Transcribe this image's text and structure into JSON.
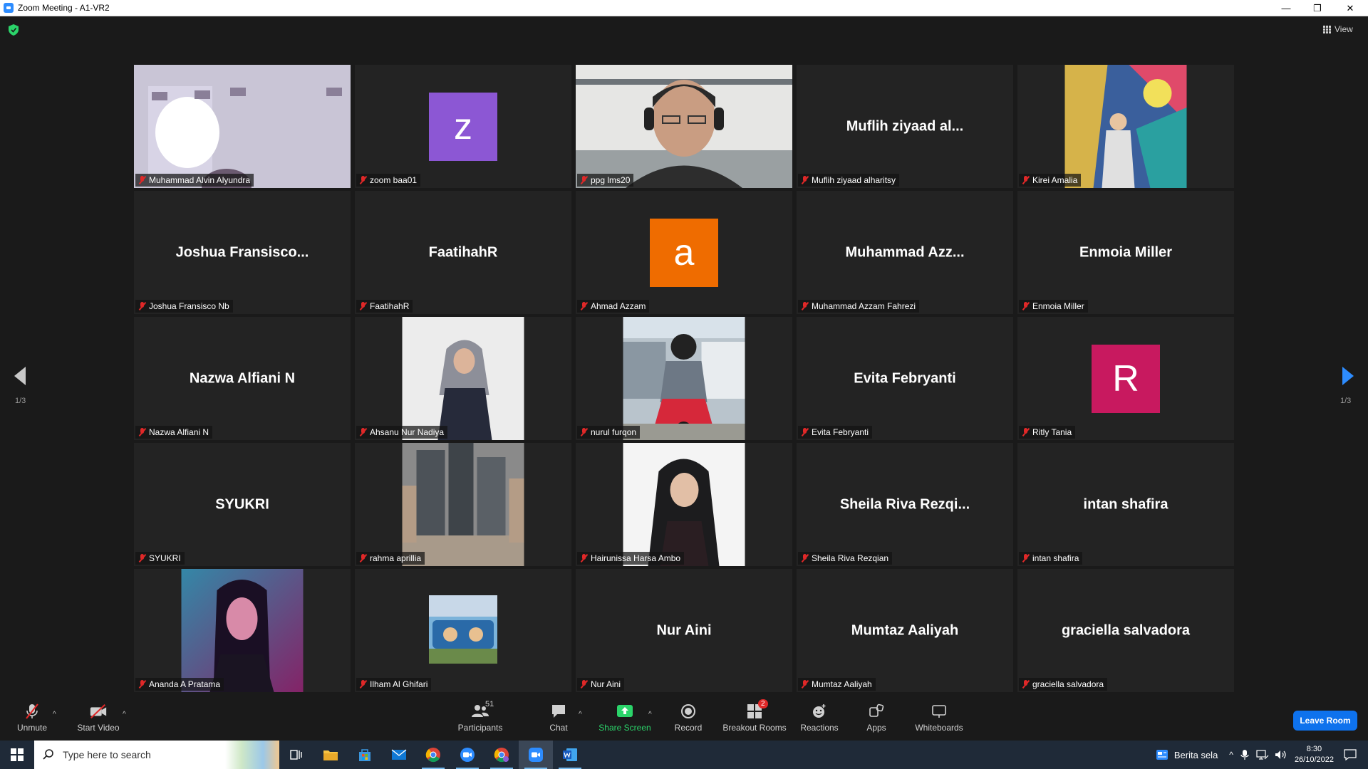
{
  "window": {
    "title": "Zoom Meeting - A1-VR2"
  },
  "meeting": {
    "view_label": "View",
    "page_left": "1/3",
    "page_right": "1/3",
    "tiles": [
      {
        "kind": "photo",
        "variant": "full",
        "art": "room",
        "name": "Muhammad Alvin Alyundra"
      },
      {
        "kind": "avatar",
        "letter": "z",
        "color": "#8c57d4",
        "name": "zoom baa01"
      },
      {
        "kind": "photo",
        "variant": "full",
        "art": "headset",
        "name": "ppg lms20",
        "active": true
      },
      {
        "kind": "text",
        "display": "Muflih ziyaad al...",
        "name": "Muflih ziyaad alharitsy"
      },
      {
        "kind": "photo",
        "variant": "narrow",
        "art": "colorful",
        "name": "Kirei Amalia"
      },
      {
        "kind": "text",
        "display": "Joshua  Fransisco...",
        "name": "Joshua Fransisco Nb"
      },
      {
        "kind": "text",
        "display": "FaatihahR",
        "name": "FaatihahR"
      },
      {
        "kind": "avatar",
        "letter": "a",
        "color": "#ef6c00",
        "name": "Ahmad Azzam"
      },
      {
        "kind": "text",
        "display": "Muhammad  Azz...",
        "name": "Muhammad Azzam Fahrezi"
      },
      {
        "kind": "text",
        "display": "Enmoia Miller",
        "name": "Enmoia Miller"
      },
      {
        "kind": "text",
        "display": "Nazwa Alfiani N",
        "name": "Nazwa Alfiani N"
      },
      {
        "kind": "photo",
        "variant": "narrow",
        "art": "hijab-white",
        "name": "Ahsanu Nur Nadiya"
      },
      {
        "kind": "photo",
        "variant": "narrow",
        "art": "motorbike",
        "name": "nurul furqon"
      },
      {
        "kind": "text",
        "display": "Evita Febryanti",
        "name": "Evita Febryanti"
      },
      {
        "kind": "avatar",
        "letter": "R",
        "color": "#c8195f",
        "name": "Ritly Tania"
      },
      {
        "kind": "text",
        "display": "SYUKRI",
        "name": "SYUKRI"
      },
      {
        "kind": "photo",
        "variant": "narrow",
        "art": "city",
        "name": "rahma aprillia"
      },
      {
        "kind": "photo",
        "variant": "narrow",
        "art": "hijab-black",
        "name": "Hairunissa Harsa Ambo"
      },
      {
        "kind": "text",
        "display": "Sheila  Riva  Rezqi...",
        "name": "Sheila Riva Rezqian"
      },
      {
        "kind": "text",
        "display": "intan shafira",
        "name": "intan shafira"
      },
      {
        "kind": "photo",
        "variant": "narrow",
        "art": "neon",
        "name": "Ananda A Pratama"
      },
      {
        "kind": "photo",
        "variant": "small",
        "art": "cartoon",
        "name": "Ilham Al Ghifari"
      },
      {
        "kind": "text",
        "display": "Nur Aini",
        "name": "Nur Aini"
      },
      {
        "kind": "text",
        "display": "Mumtaz Aaliyah",
        "name": "Mumtaz Aaliyah"
      },
      {
        "kind": "text",
        "display": "graciella salvadora",
        "name": "graciella salvadora"
      }
    ]
  },
  "toolbar": {
    "unmute": "Unmute",
    "start_video": "Start Video",
    "participants": "Participants",
    "participants_count": "51",
    "chat": "Chat",
    "share_screen": "Share Screen",
    "record": "Record",
    "breakout_rooms": "Breakout Rooms",
    "breakout_badge": "2",
    "reactions": "Reactions",
    "apps": "Apps",
    "whiteboards": "Whiteboards",
    "leave": "Leave Room"
  },
  "taskbar": {
    "search_placeholder": "Type here to search",
    "news": "Berita sela",
    "time": "8:30",
    "date": "26/10/2022"
  },
  "colors": {
    "active_speaker": "#d6f05a",
    "leave_button": "#0e72ed",
    "share_green": "#2bd46a",
    "muted_red": "#e02828"
  }
}
